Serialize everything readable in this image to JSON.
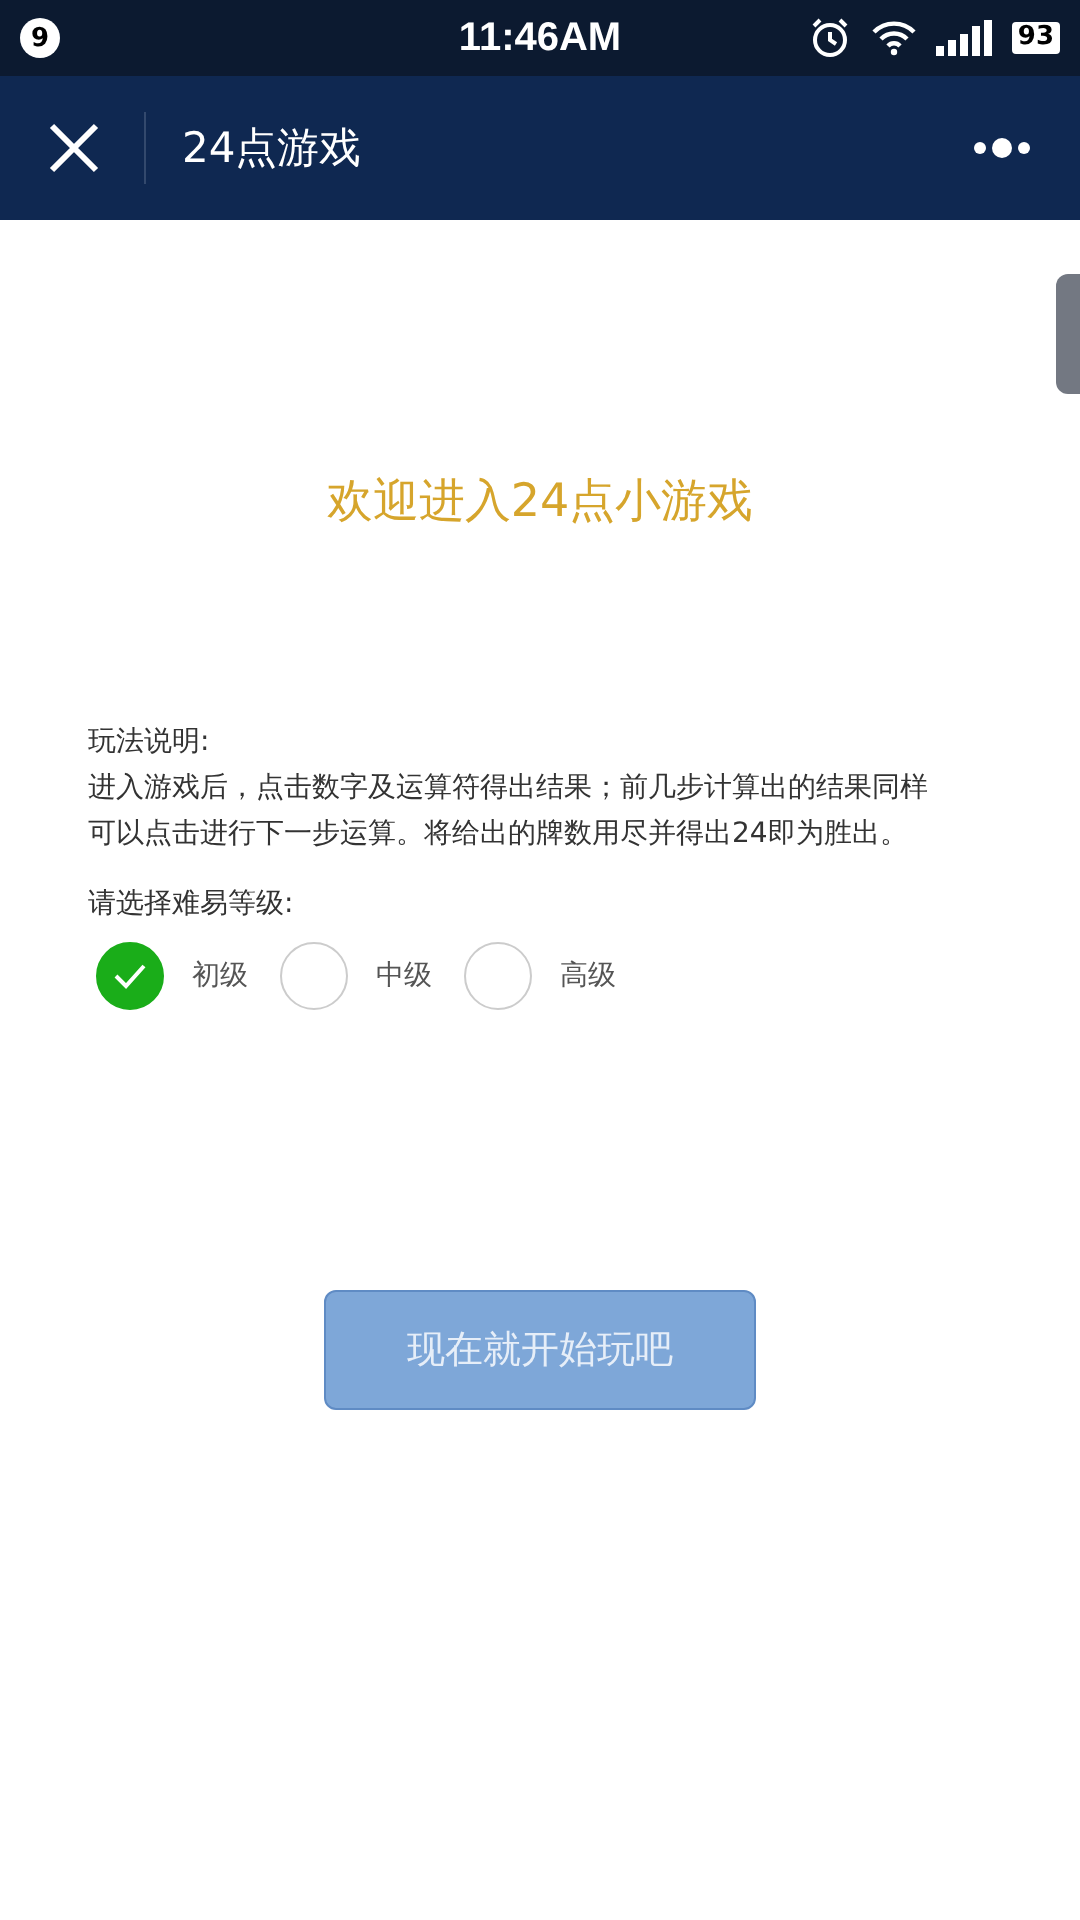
{
  "status_bar": {
    "notification_count": "9",
    "time": "11:46AM",
    "battery": "93"
  },
  "nav": {
    "title": "24点游戏"
  },
  "welcome": "欢迎进入24点小游戏",
  "instructions": {
    "heading": "玩法说明:",
    "body": "进入游戏后，点击数字及运算符得出结果；前几步计算出的结果同样可以点击进行下一步运算。将给出的牌数用尽并得出24即为胜出。"
  },
  "difficulty": {
    "label": "请选择难易等级:",
    "options": [
      {
        "label": "初级",
        "selected": true
      },
      {
        "label": "中级",
        "selected": false
      },
      {
        "label": "高级",
        "selected": false
      }
    ]
  },
  "start_button": {
    "label": "现在就开始玩吧",
    "disabled": true
  }
}
